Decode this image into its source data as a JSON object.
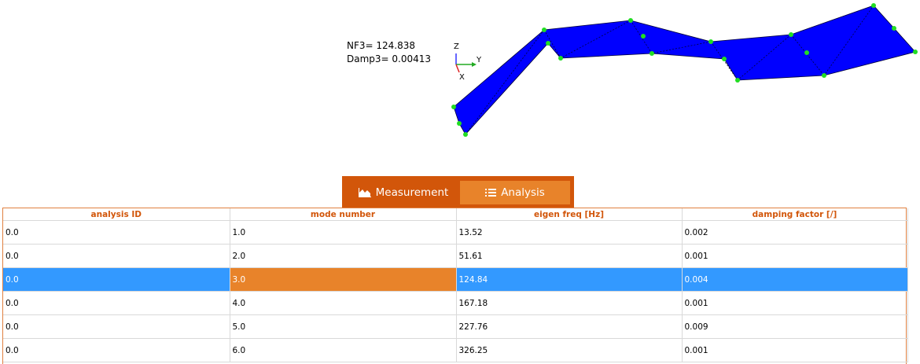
{
  "viewport": {
    "mode_label_line1": "NF3= 124.838",
    "mode_label_line2": "Damp3= 0.00413",
    "axes": {
      "z": "Z",
      "y": "Y",
      "x": "X"
    },
    "mesh_color": "#0000ff",
    "node_color": "#22dd22"
  },
  "tabs": [
    {
      "label": "Measurement",
      "icon": "area-chart-icon",
      "active": false
    },
    {
      "label": "Analysis",
      "icon": "list-icon",
      "active": true
    }
  ],
  "table": {
    "columns": [
      "analysis ID",
      "mode number",
      "eigen freq [Hz]",
      "damping factor [/]"
    ],
    "rows": [
      [
        "0.0",
        "1.0",
        "13.52",
        "0.002"
      ],
      [
        "0.0",
        "2.0",
        "51.61",
        "0.001"
      ],
      [
        "0.0",
        "3.0",
        "124.84",
        "0.004"
      ],
      [
        "0.0",
        "4.0",
        "167.18",
        "0.001"
      ],
      [
        "0.0",
        "5.0",
        "227.76",
        "0.009"
      ],
      [
        "0.0",
        "6.0",
        "326.25",
        "0.001"
      ]
    ],
    "selected_row": 2,
    "current_cell_column": 1
  },
  "colors": {
    "accent": "#d2560a",
    "tab_active": "#e8832a",
    "selection": "#3399ff",
    "header_text": "#d2560a"
  }
}
